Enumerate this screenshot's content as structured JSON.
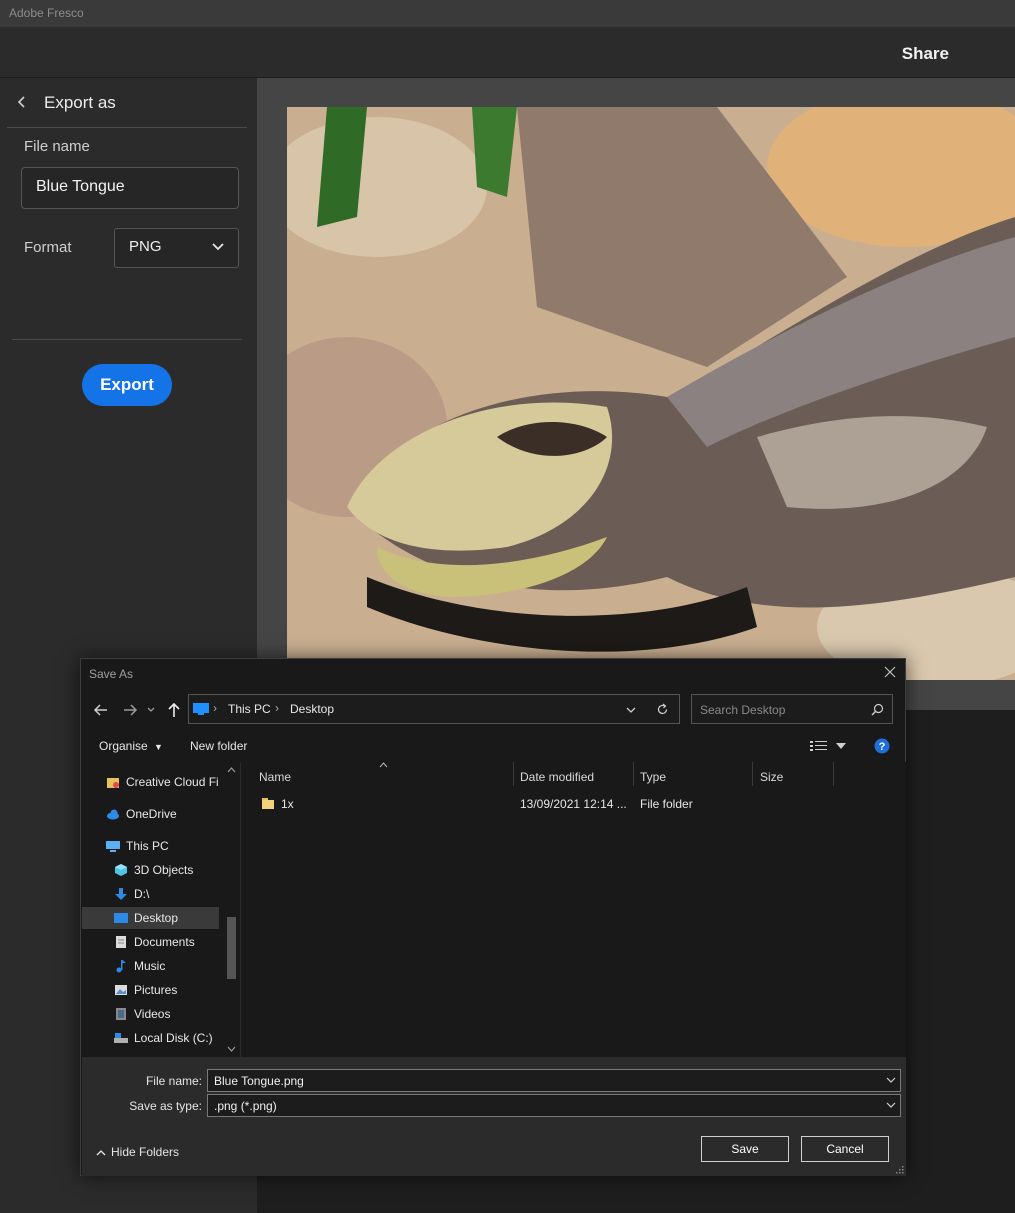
{
  "app": {
    "title": "Adobe Fresco",
    "share_label": "Share"
  },
  "export_panel": {
    "title": "Export as",
    "file_name_label": "File name",
    "file_name_value": "Blue Tongue",
    "format_label": "Format",
    "format_value": "PNG",
    "export_button": "Export",
    "accent_color": "#1473e6"
  },
  "dialog": {
    "title": "Save As",
    "breadcrumb": [
      "This PC",
      "Desktop"
    ],
    "search_placeholder": "Search Desktop",
    "toolbar": {
      "organise": "Organise",
      "new_folder": "New folder"
    },
    "nav_tree": [
      {
        "label": "Creative Cloud Fil",
        "icon": "creative-cloud-folder-icon"
      },
      {
        "label": "OneDrive",
        "icon": "cloud-icon"
      },
      {
        "label": "This PC",
        "icon": "computer-icon"
      },
      {
        "label": "3D Objects",
        "icon": "cube-icon"
      },
      {
        "label": "D:\\",
        "icon": "download-arrow-icon"
      },
      {
        "label": "Desktop",
        "icon": "desktop-icon",
        "selected": true
      },
      {
        "label": "Documents",
        "icon": "document-icon"
      },
      {
        "label": "Music",
        "icon": "music-note-icon"
      },
      {
        "label": "Pictures",
        "icon": "picture-icon"
      },
      {
        "label": "Videos",
        "icon": "film-icon"
      },
      {
        "label": "Local Disk (C:)",
        "icon": "disk-icon"
      }
    ],
    "columns": [
      "Name",
      "Date modified",
      "Type",
      "Size"
    ],
    "files": [
      {
        "name": "1x",
        "date_modified": "13/09/2021 12:14 ...",
        "type": "File folder",
        "size": ""
      }
    ],
    "file_name_label": "File name:",
    "file_name_value": "Blue Tongue.png",
    "save_as_type_label": "Save as type:",
    "save_as_type_value": ".png (*.png)",
    "hide_folders": "Hide Folders",
    "save_button": "Save",
    "cancel_button": "Cancel"
  }
}
